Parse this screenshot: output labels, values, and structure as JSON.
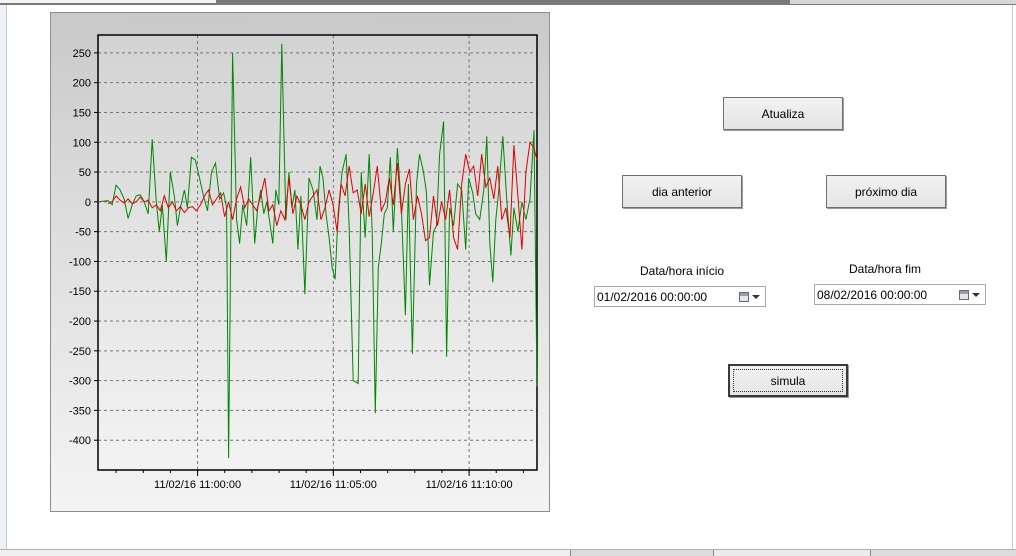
{
  "buttons": {
    "atualiza": "Atualiza",
    "dia_anterior": "dia anterior",
    "proximo_dia": "próximo dia",
    "simula": "simula"
  },
  "inputs": {
    "start_label": "Data/hora início",
    "start_value": "01/02/2016 00:00:00",
    "end_label": "Data/hora fim",
    "end_value": "08/02/2016 00:00:00"
  },
  "colors": {
    "series_green": "#008800",
    "series_red": "#e00000"
  },
  "chart_data": {
    "type": "line",
    "x_axis": "time",
    "x_tick_labels": [
      "11/02/16 11:00:00",
      "11/02/16 11:05:00",
      "11/02/16 11:10:00"
    ],
    "x_range": [
      "11:56:20",
      "11:12:30"
    ],
    "ylim": [
      -450,
      280
    ],
    "y_ticks": [
      -400,
      -350,
      -300,
      -250,
      -200,
      -150,
      -100,
      -50,
      0,
      50,
      100,
      150,
      200,
      250
    ],
    "grid": true,
    "series": [
      {
        "color": "#008800",
        "points": [
          [
            0,
            0
          ],
          [
            5,
            1
          ],
          [
            10,
            2
          ],
          [
            14,
            -5
          ],
          [
            18,
            28
          ],
          [
            22,
            20
          ],
          [
            26,
            5
          ],
          [
            30,
            -28
          ],
          [
            34,
            -5
          ],
          [
            38,
            10
          ],
          [
            42,
            12
          ],
          [
            46,
            0
          ],
          [
            50,
            -20
          ],
          [
            54,
            105
          ],
          [
            58,
            0
          ],
          [
            61,
            -50
          ],
          [
            64,
            -5
          ],
          [
            68,
            -100
          ],
          [
            72,
            50
          ],
          [
            76,
            10
          ],
          [
            79,
            -40
          ],
          [
            82,
            -10
          ],
          [
            86,
            20
          ],
          [
            89,
            -10
          ],
          [
            93,
            75
          ],
          [
            97,
            70
          ],
          [
            101,
            40
          ],
          [
            105,
            10
          ],
          [
            109,
            -15
          ],
          [
            113,
            50
          ],
          [
            117,
            65
          ],
          [
            121,
            5
          ],
          [
            125,
            15
          ],
          [
            128,
            -10
          ],
          [
            130,
            -430
          ],
          [
            134,
            250
          ],
          [
            138,
            -30
          ],
          [
            141,
            -70
          ],
          [
            144,
            -5
          ],
          [
            148,
            -40
          ],
          [
            152,
            75
          ],
          [
            156,
            -70
          ],
          [
            159,
            -10
          ],
          [
            162,
            20
          ],
          [
            165,
            -20
          ],
          [
            168,
            0
          ],
          [
            171,
            -35
          ],
          [
            174,
            -70
          ],
          [
            177,
            20
          ],
          [
            180,
            -5
          ],
          [
            183,
            265
          ],
          [
            187,
            -30
          ],
          [
            190,
            50
          ],
          [
            193,
            -10
          ],
          [
            196,
            20
          ],
          [
            199,
            -80
          ],
          [
            202,
            10
          ],
          [
            206,
            -155
          ],
          [
            210,
            40
          ],
          [
            214,
            20
          ],
          [
            218,
            -30
          ],
          [
            221,
            60
          ],
          [
            224,
            40
          ],
          [
            227,
            -20
          ],
          [
            230,
            -60
          ],
          [
            233,
            -110
          ],
          [
            236,
            -130
          ],
          [
            239,
            -20
          ],
          [
            243,
            50
          ],
          [
            247,
            80
          ],
          [
            250,
            -40
          ],
          [
            254,
            -300
          ],
          [
            259,
            -305
          ],
          [
            262,
            50
          ],
          [
            266,
            -60
          ],
          [
            270,
            80
          ],
          [
            273,
            -50
          ],
          [
            276,
            -355
          ],
          [
            279,
            -110
          ],
          [
            282,
            -70
          ],
          [
            285,
            -20
          ],
          [
            288,
            -10
          ],
          [
            291,
            75
          ],
          [
            294,
            -50
          ],
          [
            298,
            90
          ],
          [
            302,
            -10
          ],
          [
            306,
            -190
          ],
          [
            309,
            30
          ],
          [
            313,
            -255
          ],
          [
            317,
            30
          ],
          [
            320,
            80
          ],
          [
            324,
            50
          ],
          [
            327,
            15
          ],
          [
            330,
            -140
          ],
          [
            334,
            -50
          ],
          [
            337,
            -40
          ],
          [
            340,
            80
          ],
          [
            344,
            135
          ],
          [
            347,
            -260
          ],
          [
            350,
            -10
          ],
          [
            354,
            -40
          ],
          [
            358,
            30
          ],
          [
            362,
            20
          ],
          [
            366,
            -80
          ],
          [
            369,
            40
          ],
          [
            373,
            15
          ],
          [
            376,
            -20
          ],
          [
            380,
            -30
          ],
          [
            384,
            20
          ],
          [
            387,
            110
          ],
          [
            390,
            -70
          ],
          [
            393,
            -135
          ],
          [
            396,
            -30
          ],
          [
            399,
            20
          ],
          [
            403,
            110
          ],
          [
            407,
            0
          ],
          [
            411,
            -90
          ],
          [
            414,
            -10
          ],
          [
            418,
            -50
          ],
          [
            422,
            0
          ],
          [
            426,
            -30
          ],
          [
            430,
            5
          ],
          [
            434,
            120
          ],
          [
            437,
            -310
          ]
        ]
      },
      {
        "color": "#e00000",
        "points": [
          [
            10,
            -3
          ],
          [
            14,
            0
          ],
          [
            18,
            10
          ],
          [
            22,
            3
          ],
          [
            26,
            -2
          ],
          [
            30,
            5
          ],
          [
            34,
            -3
          ],
          [
            38,
            0
          ],
          [
            42,
            8
          ],
          [
            46,
            0
          ],
          [
            50,
            3
          ],
          [
            54,
            -10
          ],
          [
            58,
            -5
          ],
          [
            62,
            -15
          ],
          [
            66,
            10
          ],
          [
            70,
            -10
          ],
          [
            74,
            0
          ],
          [
            78,
            -15
          ],
          [
            82,
            -8
          ],
          [
            86,
            -18
          ],
          [
            90,
            -10
          ],
          [
            94,
            -8
          ],
          [
            98,
            -15
          ],
          [
            102,
            -5
          ],
          [
            106,
            10
          ],
          [
            110,
            20
          ],
          [
            114,
            -5
          ],
          [
            118,
            5
          ],
          [
            122,
            15
          ],
          [
            126,
            -25
          ],
          [
            130,
            0
          ],
          [
            134,
            -30
          ],
          [
            138,
            5
          ],
          [
            142,
            25
          ],
          [
            146,
            -10
          ],
          [
            150,
            5
          ],
          [
            154,
            -5
          ],
          [
            158,
            -15
          ],
          [
            162,
            10
          ],
          [
            166,
            40
          ],
          [
            170,
            -15
          ],
          [
            174,
            -5
          ],
          [
            178,
            -40
          ],
          [
            182,
            -15
          ],
          [
            186,
            -30
          ],
          [
            190,
            40
          ],
          [
            194,
            -20
          ],
          [
            198,
            10
          ],
          [
            202,
            -5
          ],
          [
            206,
            -30
          ],
          [
            210,
            0
          ],
          [
            214,
            10
          ],
          [
            218,
            20
          ],
          [
            222,
            -30
          ],
          [
            226,
            -10
          ],
          [
            230,
            20
          ],
          [
            234,
            -5
          ],
          [
            238,
            -50
          ],
          [
            242,
            30
          ],
          [
            246,
            10
          ],
          [
            250,
            60
          ],
          [
            254,
            15
          ],
          [
            258,
            20
          ],
          [
            262,
            -20
          ],
          [
            266,
            30
          ],
          [
            270,
            -25
          ],
          [
            274,
            15
          ],
          [
            278,
            60
          ],
          [
            282,
            -15
          ],
          [
            286,
            0
          ],
          [
            290,
            40
          ],
          [
            294,
            -5
          ],
          [
            298,
            65
          ],
          [
            302,
            -20
          ],
          [
            306,
            30
          ],
          [
            310,
            55
          ],
          [
            314,
            -30
          ],
          [
            318,
            10
          ],
          [
            322,
            -20
          ],
          [
            326,
            -65
          ],
          [
            330,
            -60
          ],
          [
            334,
            10
          ],
          [
            338,
            -40
          ],
          [
            342,
            0
          ],
          [
            346,
            -30
          ],
          [
            350,
            20
          ],
          [
            354,
            -60
          ],
          [
            358,
            -80
          ],
          [
            362,
            30
          ],
          [
            366,
            80
          ],
          [
            370,
            50
          ],
          [
            374,
            60
          ],
          [
            378,
            10
          ],
          [
            382,
            80
          ],
          [
            386,
            25
          ],
          [
            390,
            40
          ],
          [
            394,
            5
          ],
          [
            398,
            60
          ],
          [
            402,
            -30
          ],
          [
            406,
            -10
          ],
          [
            410,
            -60
          ],
          [
            414,
            95
          ],
          [
            418,
            10
          ],
          [
            422,
            -80
          ],
          [
            426,
            50
          ],
          [
            430,
            100
          ],
          [
            434,
            90
          ],
          [
            437,
            70
          ]
        ]
      }
    ]
  }
}
